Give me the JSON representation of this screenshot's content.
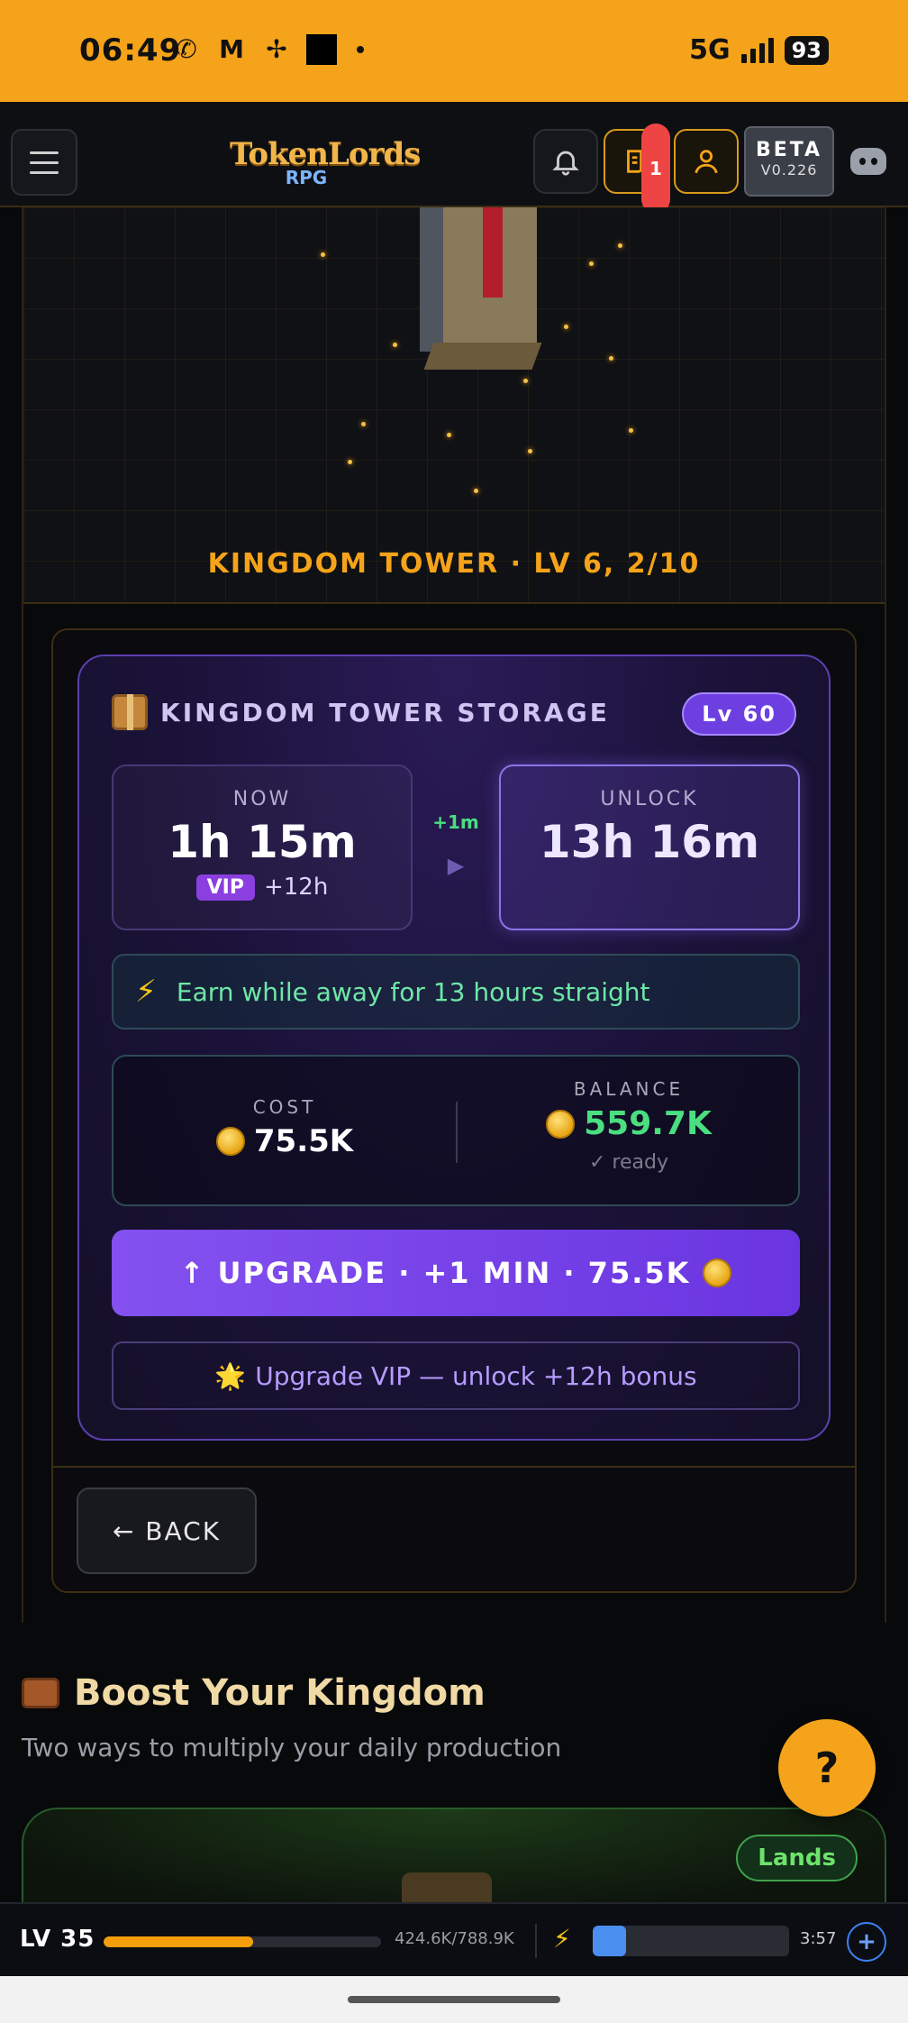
{
  "status_bar": {
    "time": "06:49",
    "network": "5G",
    "battery": "93",
    "notification_icons": [
      "whatsapp-icon",
      "gmail-icon",
      "pinwheel-icon",
      "square-app-icon"
    ]
  },
  "header": {
    "logo_top": "TokenLords",
    "logo_bottom": "RPG",
    "notification_badge": "1",
    "beta_label": "BETA",
    "version": "V0.226"
  },
  "scene": {
    "title": "KINGDOM TOWER · LV 6, 2/10"
  },
  "storage_card": {
    "title": "KINGDOM TOWER STORAGE",
    "level_badge": "Lv 60",
    "now_label": "NOW",
    "now_value": "1h 15m",
    "vip_tag": "VIP",
    "vip_bonus": "+12h",
    "delta": "+1m",
    "delta_arrow": "▶",
    "unlock_label": "UNLOCK",
    "unlock_value": "13h 16m",
    "earn_icon": "⚡",
    "earn_text": "Earn while away for 13 hours straight",
    "cost_label": "COST",
    "cost_value": "75.5K",
    "balance_label": "BALANCE",
    "balance_value": "559.7K",
    "balance_status": "✓ ready",
    "upgrade_label": "↑ UPGRADE · +1 MIN · 75.5K",
    "vip_upsell_icon": "🌟",
    "vip_upsell_text": "Upgrade VIP — unlock +12h bonus",
    "back_label": "← BACK"
  },
  "boost": {
    "title": "Boost Your Kingdom",
    "subtitle": "Two ways to multiply your daily production",
    "help_label": "?",
    "lands_label": "Lands"
  },
  "xp_bar": {
    "level": "LV 35",
    "xp_text": "424.6K/788.9K",
    "xp_fraction": 0.538,
    "energy_fraction": 0.17,
    "energy_timer": "3:57",
    "plus_label": "+"
  },
  "colors": {
    "accent": "#f5a31a",
    "purple": "#7c4dea",
    "green": "#4ade80"
  }
}
